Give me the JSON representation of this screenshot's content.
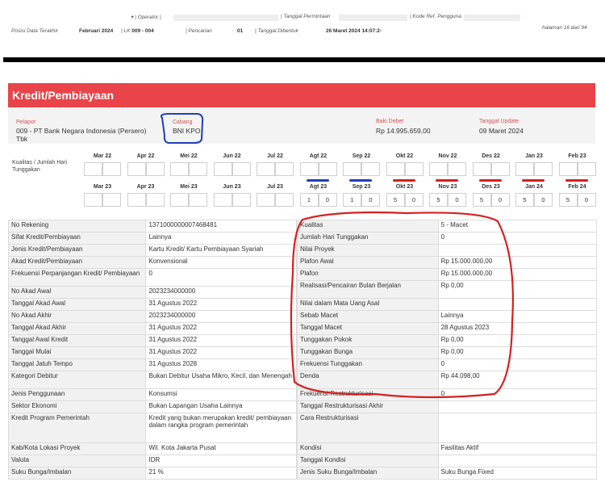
{
  "header": {
    "operator_label": "Operator",
    "tanggal_permintaan_label": "Tanggal Permintaan",
    "kode_ref_label": "Kode Ref. Pengguna",
    "posisi_label": "Posisi Data Terakhir",
    "posisi_value": "Februari 2024",
    "lk_label": "LK",
    "lk_value": "009 - 004",
    "pencarian_label": "Pencarian",
    "pencarian_value": "01",
    "tanggal_dibentuk_label": "Tanggal Dibentuk",
    "tanggal_dibentuk_value": "26 Maret 2024 14:07:2-",
    "halaman": "halaman 16 dari 94"
  },
  "section_title": "Kredit/Pembiayaan",
  "info": {
    "pelapor_label": "Pelapor",
    "pelapor_value_1": "009 - PT Bank Negara Indonesia (Persero)",
    "pelapor_value_2": "Tbk",
    "cabang_label": "Cabang",
    "cabang_value": "BNI KPO",
    "baki_label": "Baki Debet",
    "baki_value": "Rp 14.995.659,00",
    "update_label": "Tanggal Update",
    "update_value": "09 Maret 2024"
  },
  "kualitas": {
    "label_1": "Kualitas / Jumlah Hari",
    "label_2": "Tunggakan",
    "months_row1": [
      "Mar 22",
      "Apr 22",
      "Mei 22",
      "Jun 22",
      "Jul 22",
      "Agt 22",
      "Sep 22",
      "Okt 22",
      "Nov 22",
      "Des 22",
      "Jan 23",
      "Feb 23"
    ],
    "values_row1": [
      [
        "",
        ""
      ],
      [
        "",
        ""
      ],
      [
        "",
        ""
      ],
      [
        "",
        ""
      ],
      [
        "",
        ""
      ],
      [
        "",
        ""
      ],
      [
        "",
        ""
      ],
      [
        "",
        ""
      ],
      [
        "",
        ""
      ],
      [
        "",
        ""
      ],
      [
        "",
        ""
      ],
      [
        "",
        ""
      ]
    ],
    "months_row2": [
      "Mar 23",
      "Apr 23",
      "Mei 23",
      "Jun 23",
      "Jul 23",
      "Agt 23",
      "Sep 23",
      "Okt 23",
      "Nov 23",
      "Des 23",
      "Jan 24",
      "Feb 24"
    ],
    "values_row2": [
      [
        "",
        ""
      ],
      [
        "",
        ""
      ],
      [
        "",
        ""
      ],
      [
        "",
        ""
      ],
      [
        "",
        ""
      ],
      [
        "1",
        "0"
      ],
      [
        "1",
        "0"
      ],
      [
        "5",
        "0"
      ],
      [
        "5",
        "0"
      ],
      [
        "5",
        "0"
      ],
      [
        "5",
        "0"
      ],
      [
        "5",
        "0"
      ]
    ]
  },
  "left_rows": [
    {
      "k": "No Rekening",
      "v": "1371000000007468481"
    },
    {
      "k": "Sifat Kredit/Pembiayaan",
      "v": "Lainnya"
    },
    {
      "k": "Jenis Kredit/Pembiayaan",
      "v": "Kartu Kredit/ Kartu Pembiayaan Syariah"
    },
    {
      "k": "Akad Kredit/Pembiayaan",
      "v": "Konvensional"
    },
    {
      "k": "Frekuensi Perpanjangan Kredit/ Pembiayaan",
      "v": "0"
    },
    {
      "k": "No Akad Awal",
      "v": "2023234000000"
    },
    {
      "k": "Tanggal Akad Awal",
      "v": "31 Agustus 2022"
    },
    {
      "k": "No Akad Akhir",
      "v": "2023234000000"
    },
    {
      "k": "Tanggal Akad Akhir",
      "v": "31 Agustus 2022"
    },
    {
      "k": "Tanggal Awal Kredit",
      "v": "31 Agustus 2022"
    },
    {
      "k": "Tanggal Mulai",
      "v": "31 Agustus 2022"
    },
    {
      "k": "Tanggal Jatuh Tempo",
      "v": "31 Agustus 2028"
    },
    {
      "k": "Kategori Debitur",
      "v": "Bukan Debitur Usaha Mikro, Kecil, dan Menengah"
    },
    {
      "k": "Jenis Penggunaan",
      "v": "Konsumsi"
    },
    {
      "k": "Sektor Ekonomi",
      "v": "Bukan Lapangan Usaha Lainnya"
    },
    {
      "k": "Kredit Program Pemerintah",
      "v": "Kredit yang bukan merupakan kredit/ pembiayaan dalam rangka program pemerintah"
    },
    {
      "k": "Kab/Kota Lokasi Proyek",
      "v": "Wil. Kota Jakarta Pusat"
    },
    {
      "k": "Valuta",
      "v": "IDR"
    },
    {
      "k": "Suku Bunga/Imbalan",
      "v": "21 %"
    }
  ],
  "right_rows": [
    {
      "k": "Kualitas",
      "v": "5 - Macet"
    },
    {
      "k": "Jumlah Hari Tunggakan",
      "v": "0"
    },
    {
      "k": "Nilai Proyek",
      "v": ""
    },
    {
      "k": "Plafon Awal",
      "v": "Rp 15.000.000,00"
    },
    {
      "k": "Plafon",
      "v": "Rp 15.000.000,00"
    },
    {
      "k": "Realisasi/Pencairan Bulan Berjalan",
      "v": "Rp 0,00"
    },
    {
      "k": "Nilai dalam Mata Uang Asal",
      "v": ""
    },
    {
      "k": "Sebab Macet",
      "v": "Lainnya"
    },
    {
      "k": "Tanggal Macet",
      "v": "28 Agustus 2023"
    },
    {
      "k": "Tunggakan Pokok",
      "v": "Rp 0,00"
    },
    {
      "k": "Tunggakan Bunga",
      "v": "Rp 0,00"
    },
    {
      "k": "Frekuensi Tunggakan",
      "v": "0"
    },
    {
      "k": "Denda",
      "v": "Rp 44.098,00"
    },
    {
      "k": "Frekuensi Restrukturisasi",
      "v": "0"
    },
    {
      "k": "Tanggal Restrukturisasi Akhir",
      "v": ""
    },
    {
      "k": "Cara Restrukturisasi",
      "v": ""
    },
    {
      "k": "Kondisi",
      "v": "Fasilitas Aktif"
    },
    {
      "k": "Tanggal Kondisi",
      "v": ""
    },
    {
      "k": "Jenis Suku Bunga/Imbalan",
      "v": "Suku Bunga Fixed"
    }
  ]
}
